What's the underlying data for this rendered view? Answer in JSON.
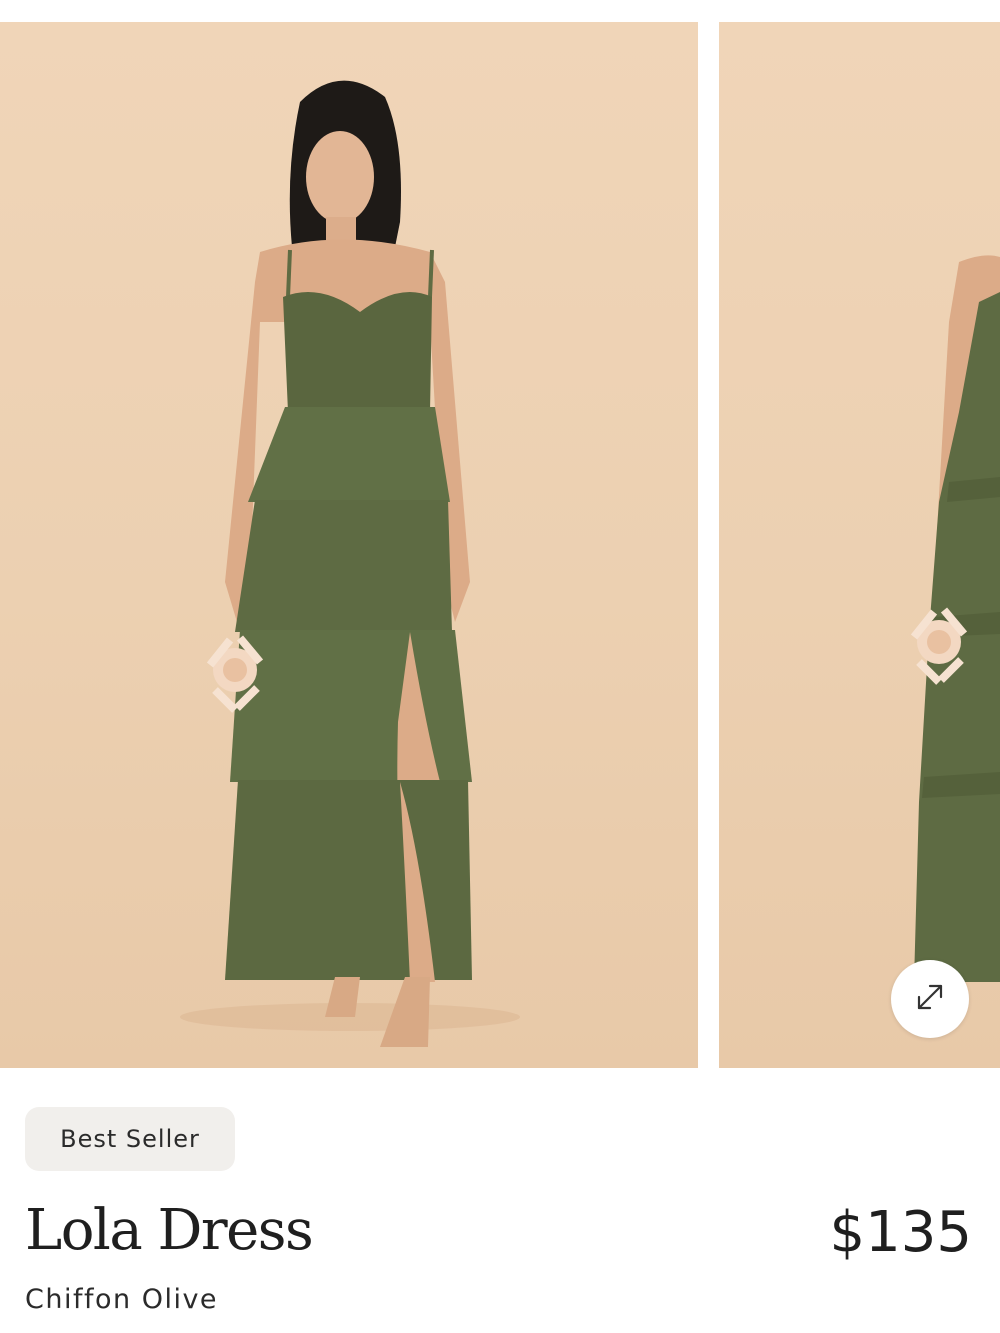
{
  "gallery": {
    "images": [
      {
        "subject": "model-wearing-olive-tiered-dress-front"
      },
      {
        "subject": "model-wearing-olive-tiered-dress-side"
      }
    ],
    "expand_icon": "expand-arrows-icon"
  },
  "product": {
    "badge": "Best Seller",
    "name": "Lola Dress",
    "price": "$135",
    "variant": "Chiffon Olive"
  },
  "colors": {
    "backdrop": "#ecd0b1",
    "dress": "#5f6b43",
    "badge_bg": "#f1efec",
    "text": "#1f1f1f"
  }
}
